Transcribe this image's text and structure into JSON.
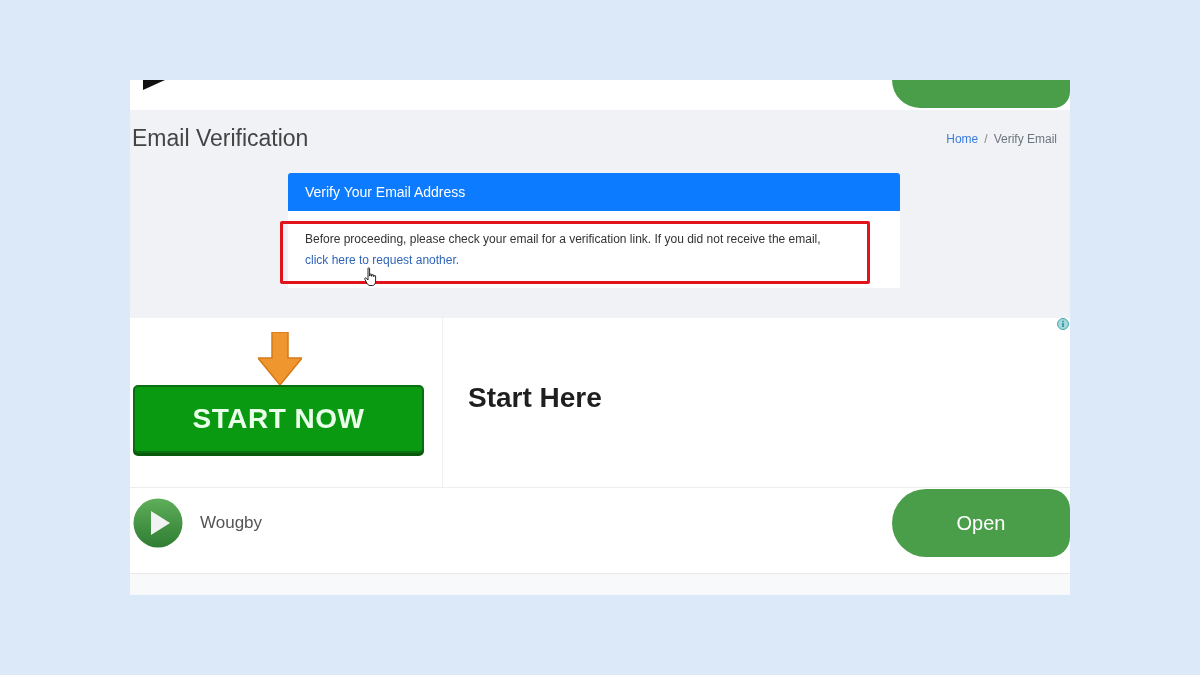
{
  "page_header": {
    "title": "Email Verification",
    "breadcrumb": [
      {
        "label": "Home",
        "kind": "link"
      },
      {
        "label": "/",
        "kind": "separator"
      },
      {
        "label": "Verify Email",
        "kind": "current"
      }
    ]
  },
  "verify_card": {
    "header": "Verify Your Email Address",
    "message": "Before proceeding, please check your email for a verification link. If you did not receive the email,",
    "link": "click here to request another.",
    "highlighted": true
  },
  "ad_banner": {
    "button": "START NOW",
    "headline": "Start Here"
  },
  "app_ad": {
    "name": "Wougby",
    "button": "Open"
  }
}
